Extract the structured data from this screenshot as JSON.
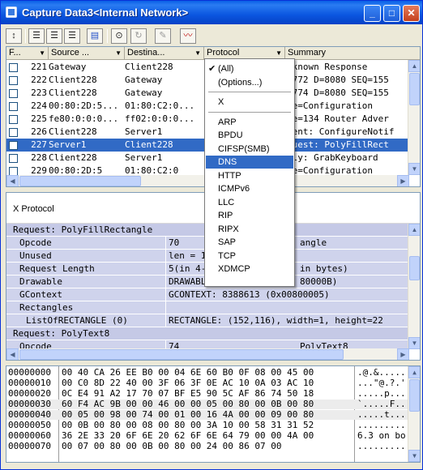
{
  "window": {
    "title": "Capture Data3<Internal Network>"
  },
  "toolbar": {
    "icons": [
      "expand-icon",
      "view-list-icon",
      "view-split-icon",
      "view-grid-icon",
      "color-icon",
      "filter-icon",
      "refresh-icon",
      "marker-icon",
      "graph-icon"
    ]
  },
  "grid": {
    "columns": [
      {
        "key": "frame",
        "label": "F..."
      },
      {
        "key": "source",
        "label": "Source ..."
      },
      {
        "key": "dest",
        "label": "Destina..."
      },
      {
        "key": "protocol",
        "label": "Protocol"
      },
      {
        "key": "summary",
        "label": "Summary"
      }
    ],
    "rows": [
      {
        "frame": "221",
        "source": "Gateway",
        "dest": "Client228",
        "summary": "nknown Response"
      },
      {
        "frame": "222",
        "source": "Client228",
        "dest": "Gateway",
        "summary": "4772 D=8080 SEQ=155"
      },
      {
        "frame": "223",
        "source": "Client228",
        "dest": "Gateway",
        "summary": "4774 D=8080 SEQ=155"
      },
      {
        "frame": "224",
        "source": "00:80:2D:5...",
        "dest": "01:80:C2:0...",
        "summary": "pe=Configuration"
      },
      {
        "frame": "225",
        "source": "fe80:0:0:0...",
        "dest": "ff02:0:0:0...",
        "summary": "pe=134 Router Adver"
      },
      {
        "frame": "226",
        "source": "Client228",
        "dest": "Server1",
        "summary": "vent: ConfigureNotif"
      },
      {
        "frame": "227",
        "source": "Server1",
        "dest": "Client228",
        "summary": "quest: PolyFillRect",
        "selected": true
      },
      {
        "frame": "228",
        "source": "Client228",
        "dest": "Server1",
        "summary": "ply: GrabKeyboard"
      },
      {
        "frame": "229",
        "source": "00:80:2D:5",
        "dest": "01:80:C2:0",
        "summary": "pe=Configuration"
      }
    ]
  },
  "protocol_menu": {
    "items": [
      {
        "label": "(All)",
        "checked": true
      },
      {
        "label": "(Options...)"
      },
      {
        "sep": true
      },
      {
        "label": "X"
      },
      {
        "sep": true
      },
      {
        "label": "ARP"
      },
      {
        "label": "BPDU"
      },
      {
        "label": "CIFSP(SMB)"
      },
      {
        "label": "DNS",
        "active": true
      },
      {
        "label": "HTTP"
      },
      {
        "label": "ICMPv6"
      },
      {
        "label": "LLC"
      },
      {
        "label": "RIP"
      },
      {
        "label": "RIPX"
      },
      {
        "label": "SAP"
      },
      {
        "label": "TCP"
      },
      {
        "label": "XDMCP"
      }
    ]
  },
  "detail": {
    "header": "X Protocol",
    "rows": [
      {
        "name": "Request: PolyFillRectangle",
        "value": "",
        "indent": 0,
        "section": true
      },
      {
        "name": "Opcode",
        "value": "70",
        "value2": "angle",
        "indent": 1
      },
      {
        "name": "Unused",
        "value": "len = 1",
        "indent": 1
      },
      {
        "name": "Request Length",
        "value": "5(in 4-",
        "value2": "in bytes)",
        "indent": 1
      },
      {
        "name": "Drawable",
        "value": "DRAWABL",
        "value2": "80000B)",
        "indent": 1
      },
      {
        "name": "GContext",
        "value": "GCONTEXT: 8388613 (0x00800005)",
        "indent": 1
      },
      {
        "name": "Rectangles",
        "value": "",
        "indent": 1
      },
      {
        "name": "ListOfRECTANGLE (0)",
        "value": "RECTANGLE: (152,116), width=1, height=22",
        "indent": 2
      },
      {
        "name": "Request: PolyText8",
        "value": "",
        "indent": 0,
        "section": true
      },
      {
        "name": "Opcode",
        "value": "74",
        "value2": "PolyText8",
        "indent": 1
      }
    ]
  },
  "hex": {
    "rows": [
      {
        "offset": "00000000",
        "bytes": "00 40 CA 26  EE B0 00 04  6E 60 B0 0F  08 00 45 00",
        "ascii": ".@.&......"
      },
      {
        "offset": "00000010",
        "bytes": "00 C0 8D 22  40 00 3F 06  3F 0E AC 10  0A 03 AC 10",
        "ascii": "...\"@.?.'"
      },
      {
        "offset": "00000020",
        "bytes": "0C E4 91 A2  17 70 07 BF  E5 90 5C AF  86 74 50 18",
        "ascii": ".....p...."
      },
      {
        "offset": "00000030",
        "bytes": "60 F4 AC 9B  00 00 46 00  00 05 00 80  00 0B 00 80",
        "ascii": "`.....F..."
      },
      {
        "offset": "00000040",
        "bytes": "00 05 00 98  00 74 00 01  00 16 4A 00  00 09 00 80",
        "ascii": ".....t...."
      },
      {
        "offset": "00000050",
        "bytes": "00 0B 00 80  00 08 00 80  00 3A 10 00  58 31 31 52",
        "ascii": ".........."
      },
      {
        "offset": "00000060",
        "bytes": "36 2E 33 20  6F 6E 20 62  6F 6E 64 79  00 00 4A 00",
        "ascii": "6.3 on bo"
      },
      {
        "offset": "00000070",
        "bytes": "00 07 00 80  00 0B 00 80  00 24 00 86  07 00",
        "ascii": ".........."
      }
    ]
  }
}
